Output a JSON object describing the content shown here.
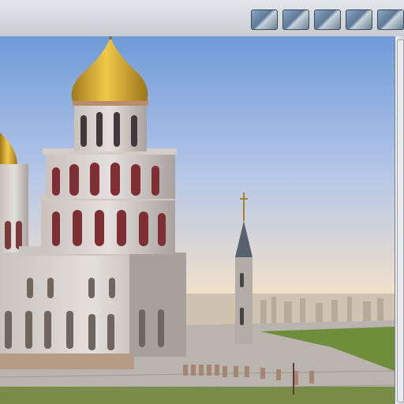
{
  "window": {
    "thumbnails": [
      {
        "id": "thumb-1",
        "icon": "image-icon"
      },
      {
        "id": "thumb-2",
        "icon": "image-icon"
      },
      {
        "id": "thumb-3",
        "icon": "image-icon"
      },
      {
        "id": "thumb-4",
        "icon": "image-icon"
      },
      {
        "id": "thumb-5",
        "icon": "image-icon"
      }
    ]
  },
  "scene": {
    "colors": {
      "sky_top": "#6f9bd8",
      "sky_bottom": "#f2e1c9",
      "dome_gold": "#d9ad33",
      "stone": "#d8d3cf",
      "grass": "#6f8d3a"
    }
  }
}
